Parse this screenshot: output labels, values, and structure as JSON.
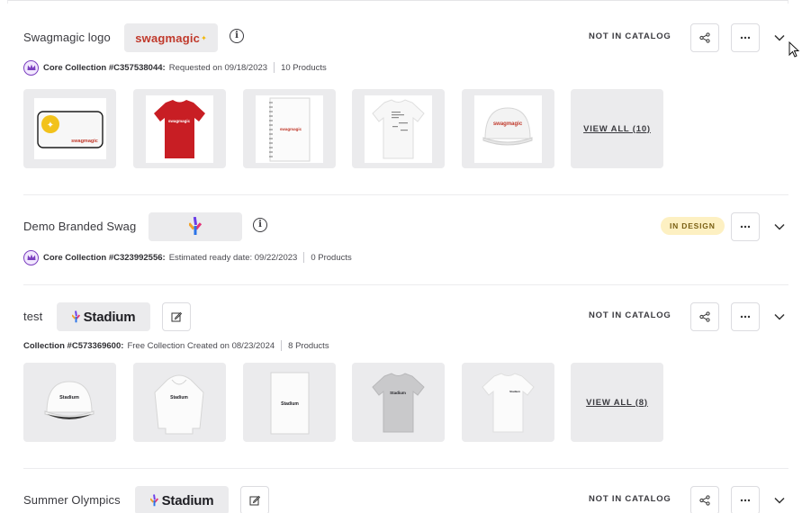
{
  "collections": [
    {
      "name": "Swagmagic logo",
      "logo_text": "swagmagic",
      "status": "NOT IN CATALOG",
      "meta_id": "Core Collection #C357538044",
      "meta_date": "Requested on 09/18/2023",
      "meta_count": "10 Products",
      "thumbs": [
        {
          "icon": "laptop-sleeve-image",
          "label": "swagmagic"
        },
        {
          "icon": "red-tshirt-image",
          "label": "swagmagic"
        },
        {
          "icon": "notebook-image",
          "label": "swagmagic"
        },
        {
          "icon": "white-tshirt-image",
          "label": ""
        },
        {
          "icon": "white-cap-image",
          "label": "swagmagic"
        }
      ],
      "view_all": "VIEW ALL (10)"
    },
    {
      "name": "Demo Branded Swag",
      "logo_text": "",
      "status": "IN DESIGN",
      "meta_id": "Core Collection #C323992556",
      "meta_date": "Estimated ready date: 09/22/2023",
      "meta_count": "0 Products"
    },
    {
      "name": "test",
      "logo_text": "Stadium",
      "status": "NOT IN CATALOG",
      "meta_id": "Collection #C573369600",
      "meta_date": "Free Collection Created on 08/23/2024",
      "meta_count": "8 Products",
      "thumbs": [
        {
          "icon": "white-cap-image",
          "label": "Stadium"
        },
        {
          "icon": "white-hoodie-image",
          "label": "Stadium"
        },
        {
          "icon": "white-notebook-image",
          "label": "Stadium"
        },
        {
          "icon": "grey-tshirt-image",
          "label": "Stadium"
        },
        {
          "icon": "white-tshirt-image",
          "label": "Stadium"
        }
      ],
      "view_all": "VIEW ALL (8)"
    },
    {
      "name": "Summer Olympics",
      "logo_text": "Stadium",
      "status": "NOT IN CATALOG"
    }
  ],
  "colors": {
    "accent_red": "#c0392b",
    "in_design_bg": "#fdf0c2",
    "crown_purple": "#7b3fbf",
    "chip_bg": "#ebebed"
  }
}
